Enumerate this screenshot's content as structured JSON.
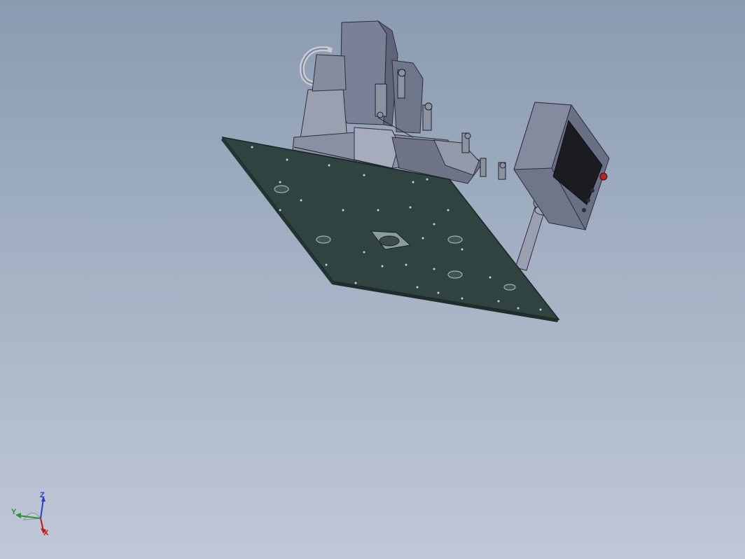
{
  "viewport": {
    "background_top": "#8a9bb0",
    "background_bottom": "#bfc8d6"
  },
  "model": {
    "base_plate_color": "#2f4440",
    "machine_color": "#787e92",
    "panel_screen_color": "#1a1c20",
    "estop_color": "#c0201c"
  },
  "triad": {
    "z_label": "Z",
    "y_label": "Y",
    "x_label": "X",
    "z_color": "#2a3bd6",
    "y_color": "#1f9a2c",
    "x_color": "#c0181c"
  }
}
